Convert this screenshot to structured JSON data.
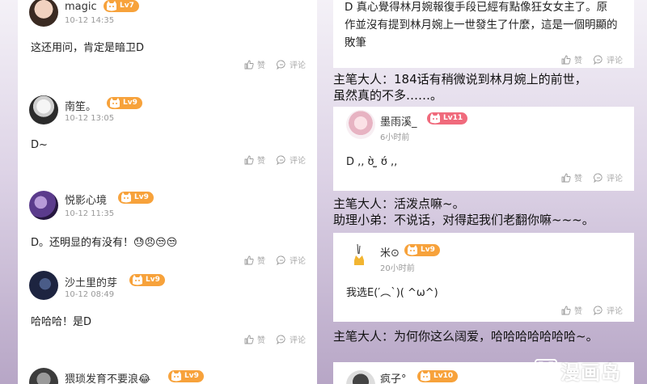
{
  "left_column": {
    "comments": [
      {
        "name": "magic",
        "level": "Lv7",
        "time": "10-12 14:35",
        "content": "这还用问，肯定是暗卫D",
        "like_label": "赞",
        "reply_label": "评论",
        "avatar": "avatar-face"
      },
      {
        "name": "南笙。",
        "level": "Lv9",
        "time": "10-12 13:05",
        "content": "D~",
        "like_label": "赞",
        "reply_label": "评论",
        "avatar": "avatar-anime-white"
      },
      {
        "name": "悦影心境",
        "level": "Lv9",
        "time": "10-12 11:35",
        "content": "D。还明显的有没有！😓😠😒😒",
        "like_label": "赞",
        "reply_label": "评论",
        "avatar": "avatar-purple"
      },
      {
        "name": "沙土里的芽",
        "level": "Lv9",
        "time": "10-12 08:49",
        "content": "哈哈哈！是D",
        "like_label": "赞",
        "reply_label": "评论",
        "avatar": "avatar-dark"
      },
      {
        "name": "猥琐发育不要浪😂",
        "level": "Lv9",
        "avatar": "avatar-grey"
      }
    ]
  },
  "right_column": {
    "top_comment": {
      "content": "D 真心覺得林月婉報復手段已經有點像狂女女主了。原作並沒有提到林月婉上一世發生了什麼，這是一個明顯的敗筆",
      "like_label": "赞",
      "reply_label": "评论"
    },
    "caption_1": [
      "主笔大人：184话有稍微说到林月婉上的前世，",
      "虽然真的不多……。"
    ],
    "comment_2": {
      "name": "墨雨溪_",
      "level": "Lv11",
      "time": "6小时前",
      "content": "D ,, ʊ̀ ̫ ʊ́ ,,",
      "like_label": "赞",
      "reply_label": "评论"
    },
    "caption_2": [
      "主笔大人：活泼点嘛~。",
      "助理小弟：不说话，对得起我们老翻你嘛~~~。"
    ],
    "comment_3": {
      "name": "米⊙",
      "level": "Lv9",
      "time": "20小时前",
      "content": "我选E(′︵`)( ^ω^)",
      "like_label": "赞",
      "reply_label": "评论"
    },
    "caption_3": "主笔大人：为何你这么阔爱，哈哈哈哈哈哈哈~。",
    "comment_4": {
      "name": "疯子°",
      "level": "Lv10"
    }
  },
  "watermark": {
    "letter": "M",
    "text": "漫画岛"
  },
  "colors": {
    "badge_orange": "#f7a23b",
    "badge_red": "#f06a7c",
    "background_bottom": "#b7a6c6"
  }
}
